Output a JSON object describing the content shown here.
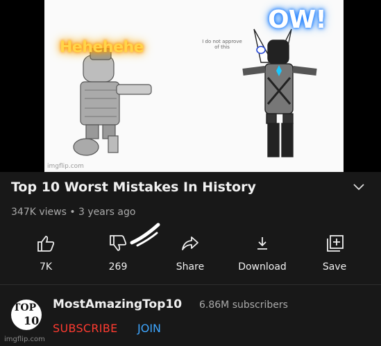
{
  "thumbnail": {
    "left_caption": "Hehehehe",
    "right_caption": "OW!",
    "small_text": "I do not approve of this",
    "watermark": "imgflip.com"
  },
  "video": {
    "title": "Top 10 Worst Mistakes In History",
    "meta": "347K views • 3 years ago"
  },
  "actions": {
    "like": "7K",
    "dislike": "269",
    "share": "Share",
    "download": "Download",
    "save": "Save"
  },
  "channel": {
    "avatar_line1": "TOP",
    "avatar_line2": "10",
    "name": "MostAmazingTop10",
    "subscribers": "6.86M subscribers",
    "subscribe_label": "SUBSCRIBE",
    "join_label": "JOIN"
  },
  "footer": {
    "watermark": "imgflip.com"
  },
  "colors": {
    "background": "#181818",
    "subscribe": "#ff3b30",
    "join": "#3ea6ff",
    "meta": "#aaaaaa"
  }
}
